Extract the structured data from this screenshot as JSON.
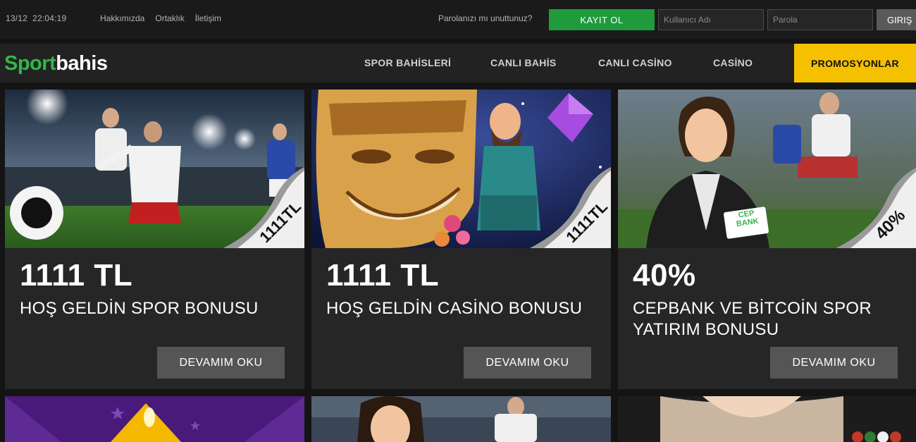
{
  "topbar": {
    "date": "13/12",
    "time": "22:04:19",
    "links": [
      "Hakkımızda",
      "Ortaklık",
      "İletişim"
    ],
    "forgot": "Parolanızı mı unuttunuz?",
    "register_label": "KAYIT OL",
    "username_placeholder": "Kullanıcı Adı",
    "password_placeholder": "Parola",
    "login_label": "GIRIŞ"
  },
  "brand": {
    "part1": "Sport",
    "part2": "bahis",
    "green": "#33b64a"
  },
  "nav": {
    "items": [
      "SPOR BAHİSLERİ",
      "CANLI BAHİS",
      "CANLI CASİNO",
      "CASİNO"
    ],
    "promo": "PROMOSYONLAR",
    "promo_color": "#f5c000"
  },
  "promos": [
    {
      "amount": "1111 TL",
      "title": "HOŞ GELDİN SPOR BONUSU",
      "badge": "1111TL",
      "button": "DEVAMIM OKU"
    },
    {
      "amount": "1111 TL",
      "title": "HOŞ GELDİN CASİNO BONUSU",
      "badge": "1111TL",
      "button": "DEVAMIM OKU"
    },
    {
      "amount": "40%",
      "title": "CEPBANK VE BİTCOİN SPOR YATIRIM BONUSU",
      "badge": "40%",
      "button": "DEVAMIM OKU",
      "card_label": "CEP BANK"
    }
  ]
}
